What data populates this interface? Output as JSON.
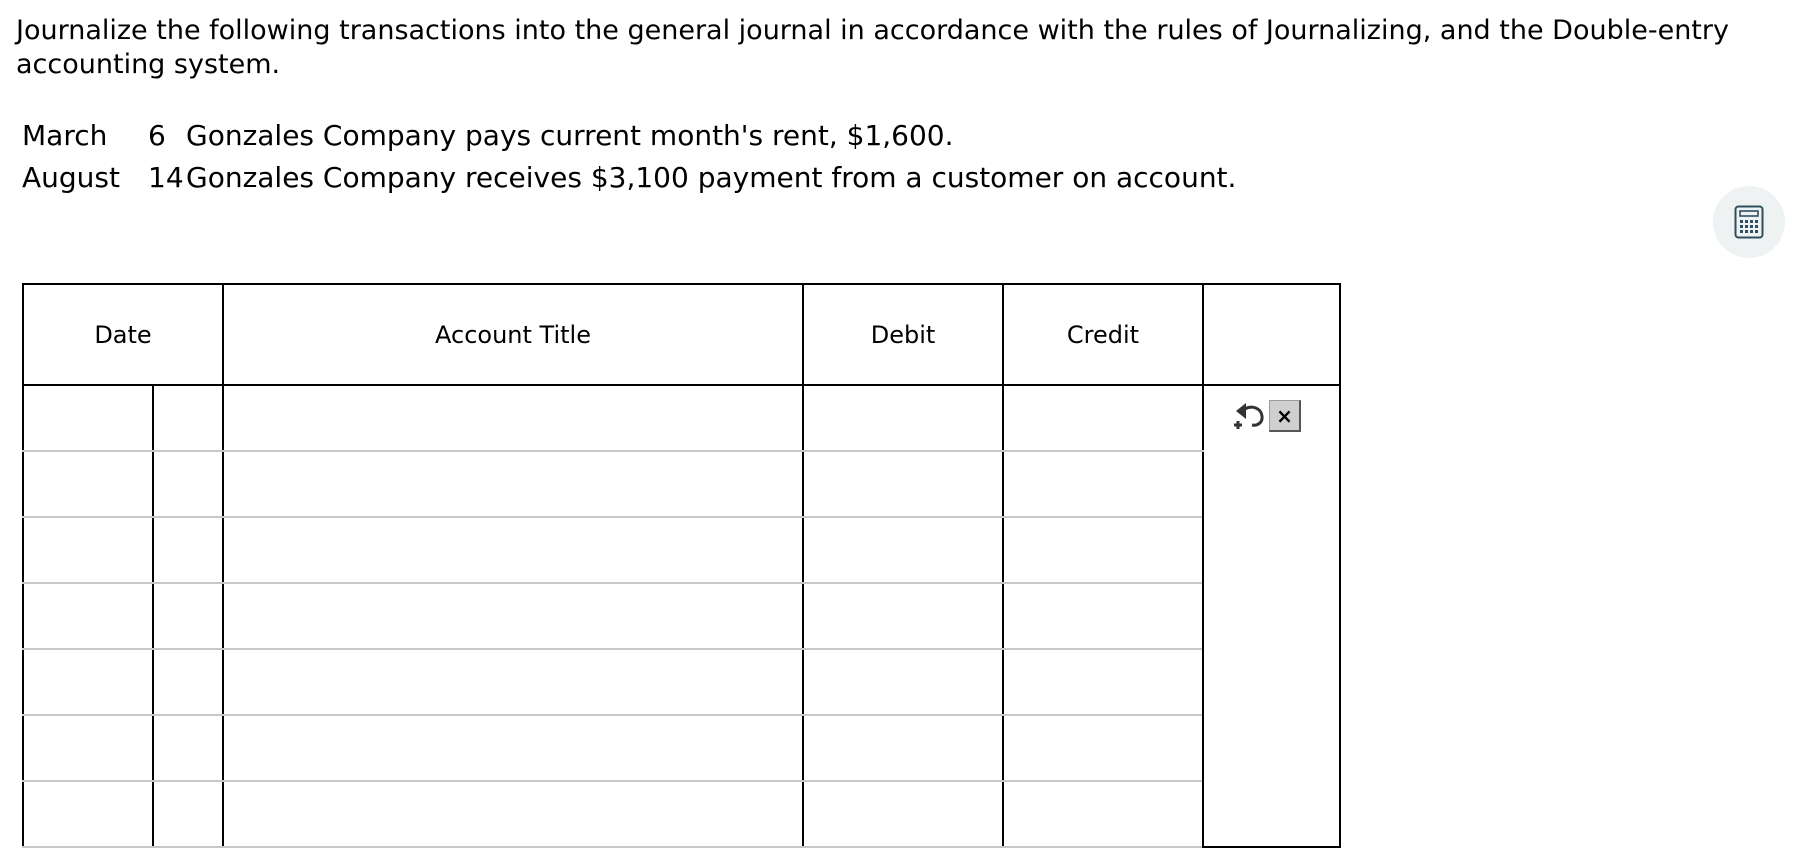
{
  "instructions": "Journalize the following transactions into the general journal in accordance with the rules of Journalizing, and the Double-entry accounting system.",
  "transactions": [
    {
      "month": "March",
      "day": "6",
      "description": "Gonzales Company pays current month's rent, $1,600."
    },
    {
      "month": "August",
      "day": "14",
      "description": "Gonzales Company receives $3,100 payment from a customer on account."
    }
  ],
  "calculator": {
    "icon": "calculator-icon"
  },
  "journal": {
    "headers": {
      "date": "Date",
      "account_title": "Account Title",
      "debit": "Debit",
      "credit": "Credit",
      "actions": ""
    },
    "rows": [
      {
        "month": "",
        "day": "",
        "account": "",
        "debit": "",
        "credit": ""
      },
      {
        "month": "",
        "day": "",
        "account": "",
        "debit": "",
        "credit": ""
      },
      {
        "month": "",
        "day": "",
        "account": "",
        "debit": "",
        "credit": ""
      },
      {
        "month": "",
        "day": "",
        "account": "",
        "debit": "",
        "credit": ""
      },
      {
        "month": "",
        "day": "",
        "account": "",
        "debit": "",
        "credit": ""
      },
      {
        "month": "",
        "day": "",
        "account": "",
        "debit": "",
        "credit": ""
      },
      {
        "month": "",
        "day": "",
        "account": "",
        "debit": "",
        "credit": ""
      }
    ],
    "actions": {
      "undo_icon": "undo-icon",
      "clear_label": "×"
    }
  }
}
